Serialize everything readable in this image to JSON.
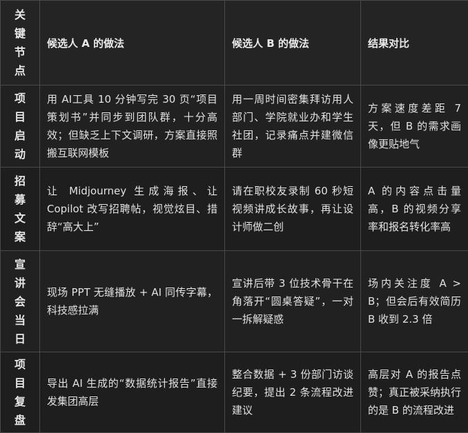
{
  "headers": {
    "node": "关键节点",
    "a": "候选人 A 的做法",
    "b": "候选人 B 的做法",
    "result": "结果对比"
  },
  "rows": [
    {
      "node": "项目启动",
      "a": "用 AI工具 10 分钟写完 30 页“项目策划书”并同步到团队群，十分高效；但缺乏上下文调研，方案直接照搬互联网模板",
      "b": "用一周时间密集拜访用人部门、学院就业办和学生社团，记录痛点并建微信群",
      "result": "方案速度差距 7 天，但 B 的需求画像更贴地气"
    },
    {
      "node": "招募文案",
      "a": "让 Midjourney 生成海报、让 Copilot 改写招聘帖，视觉炫目、措辞“高大上”",
      "b": "请在职校友录制 60 秒短视频讲成长故事，再让设计师做二创",
      "result": "A 的内容点击量高，B 的视频分享率和报名转化率高"
    },
    {
      "node": "宣讲会当日",
      "a": "现场 PPT 无缝播放 + AI 同传字幕，科技感拉满",
      "b": "宣讲后带 3 位技术骨干在角落开“圆桌答疑”，一对一拆解疑惑",
      "result": "场内关注度 A > B；但会后有效简历 B 收到 2.3 倍"
    },
    {
      "node": "项目复盘",
      "a": "导出 AI 生成的“数据统计报告”直接发集团高层",
      "b": "整合数据 + 3 份部门访谈纪要，提出 2 条流程改进建议",
      "result": "高层对 A 的报告点赞；真正被采纳执行的是 B 的流程改进"
    }
  ]
}
